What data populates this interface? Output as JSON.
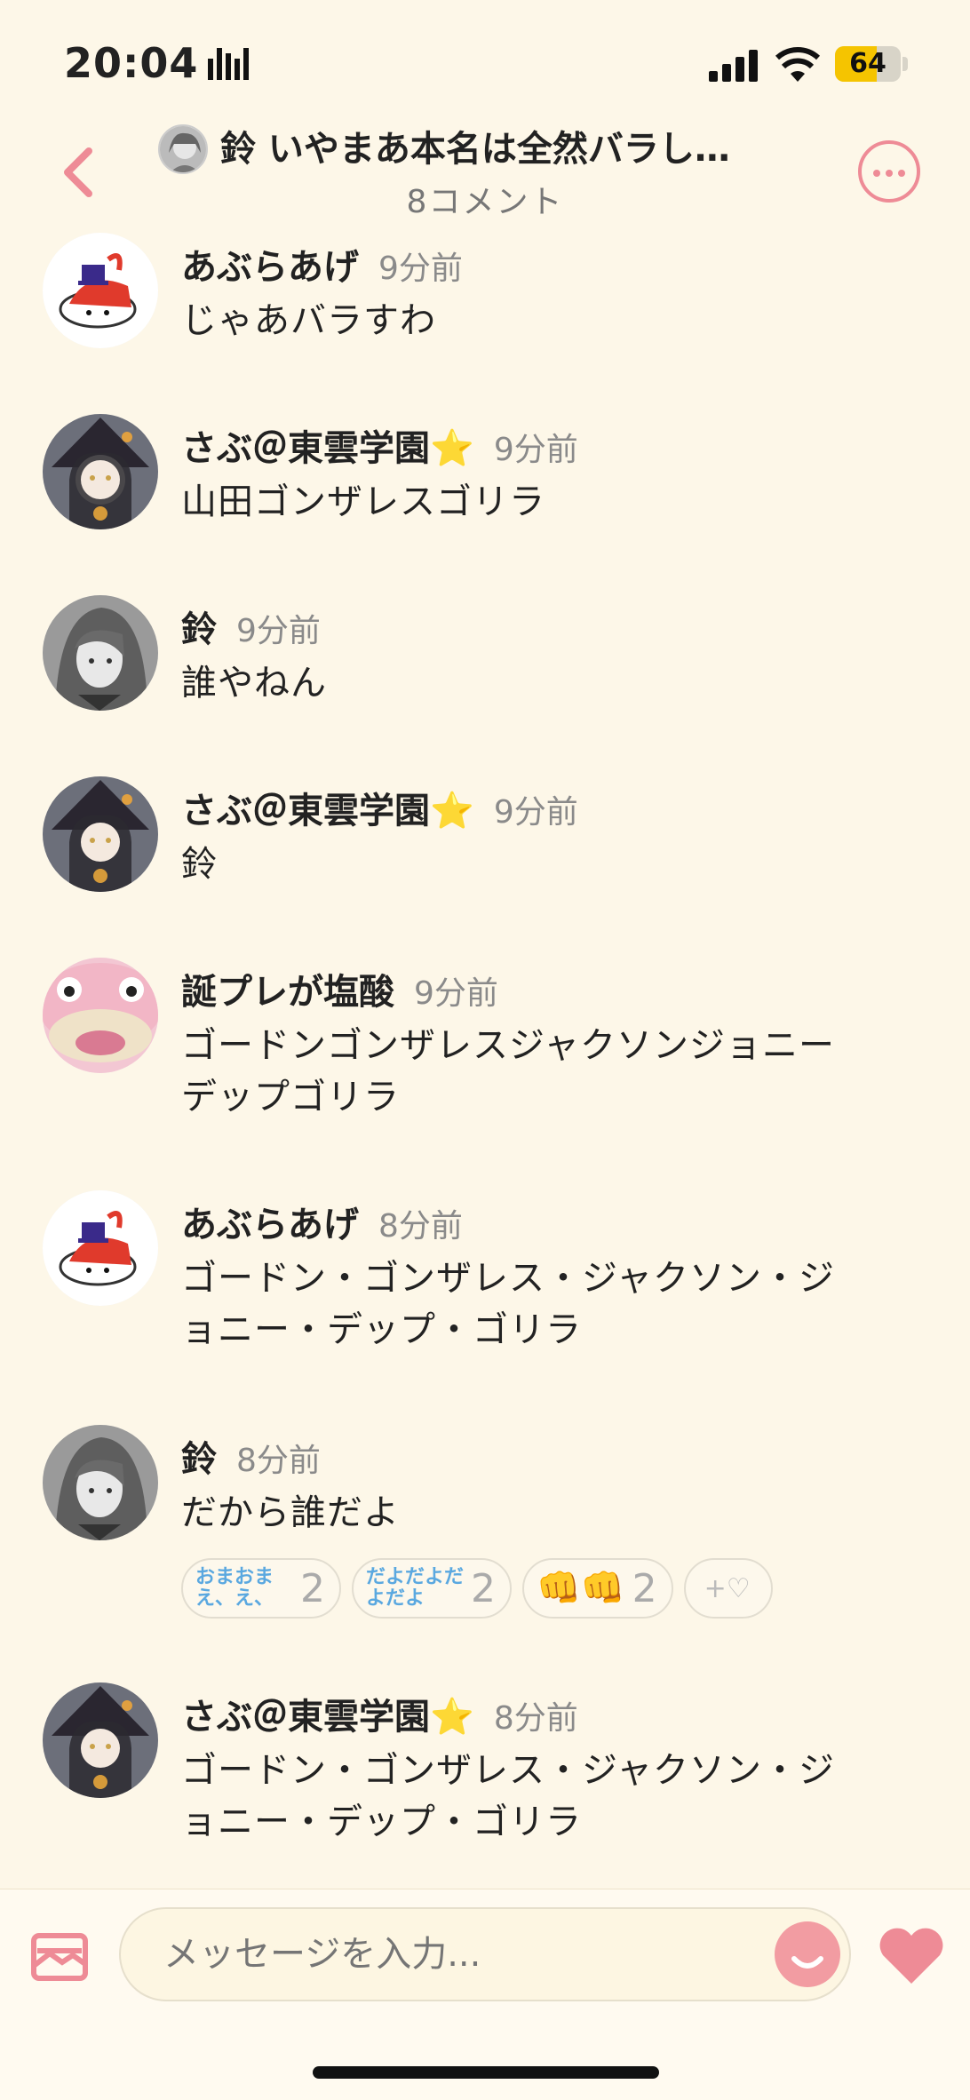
{
  "status_bar": {
    "time": "20:04",
    "battery": "64",
    "battery_level": 0.64
  },
  "header": {
    "title": "鈴 いやまあ本名は全然バラし…",
    "subtitle": "8コメント"
  },
  "comments": [
    {
      "name": "あぶらあげ",
      "time": "9分前",
      "lines": [
        "じゃあバラすわ"
      ]
    },
    {
      "name": "さぶ＠東雲学園⭐",
      "time": "9分前",
      "lines": [
        "山田ゴンザレスゴリラ"
      ]
    },
    {
      "name": "鈴",
      "time": "9分前",
      "lines": [
        "誰やねん"
      ]
    },
    {
      "name": "さぶ＠東雲学園⭐",
      "time": "9分前",
      "lines": [
        "鈴"
      ]
    },
    {
      "name": "誕プレが塩酸",
      "time": "9分前",
      "lines": [
        "ゴードンゴンザレスジャクソンジョニー",
        "デップゴリラ"
      ]
    },
    {
      "name": "あぶらあげ",
      "time": "8分前",
      "lines": [
        "ゴードン・ゴンザレス・ジャクソン・ジ",
        "ョニー・デップ・ゴリラ"
      ]
    },
    {
      "name": "鈴",
      "time": "8分前",
      "lines": [
        "だから誰だよ"
      ],
      "reactions": [
        {
          "label": "おまおまえ、え、",
          "count": "2"
        },
        {
          "label": "だよだよだよだよ",
          "count": "2"
        },
        {
          "label": "👊👊",
          "count": "2"
        }
      ],
      "add_reaction": "+♡"
    },
    {
      "name": "さぶ＠東雲学園⭐",
      "time": "8分前",
      "lines": [
        "ゴードン・ゴンザレス・ジャクソン・ジ",
        "ョニー・デップ・ゴリラ"
      ]
    }
  ],
  "composer": {
    "placeholder": "メッセージを入力..."
  },
  "colors": {
    "accent": "#ee8b96",
    "background": "#fdf7e8"
  }
}
